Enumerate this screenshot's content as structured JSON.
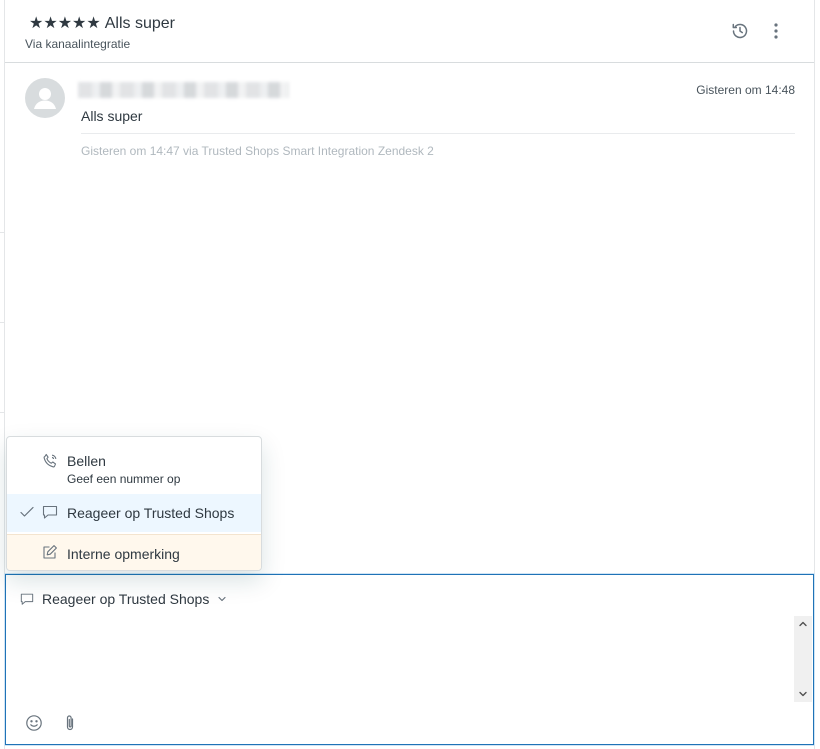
{
  "ticket": {
    "stars": "★★★★★",
    "title": "Alls super",
    "subtitle": "Via kanaalintegratie"
  },
  "header_icons": {
    "history": "history-icon",
    "more": "more-vertical-icon"
  },
  "message": {
    "time": "Gisteren om 14:48",
    "body": "Alls super",
    "meta": "Gisteren om 14:47 via Trusted Shops Smart Integration Zendesk 2"
  },
  "menu": {
    "call_label": "Bellen",
    "call_sub": "Geef een nummer op",
    "reply_label": "Reageer op Trusted Shops",
    "note_label": "Interne opmerking",
    "selected": "reply"
  },
  "composer": {
    "channel_label": "Reageer op Trusted Shops",
    "value": ""
  },
  "colors": {
    "focus_border": "#1f73b7",
    "selected_bg": "#edf7ff",
    "note_bg": "#fff8ed"
  }
}
